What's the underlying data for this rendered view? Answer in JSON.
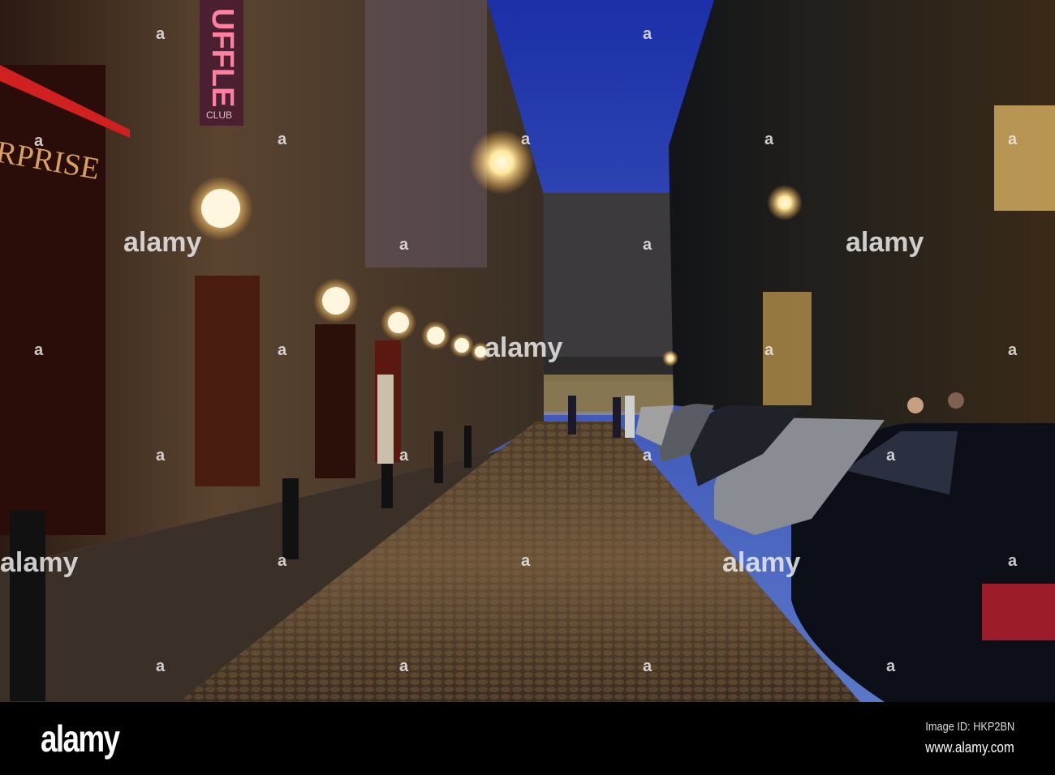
{
  "photo": {
    "signs": {
      "left_sign": "ERPRISE",
      "club_sign": "UFFLE",
      "club_subtitle": "CLUB"
    },
    "watermark": {
      "text": "alamy",
      "mark": "a"
    }
  },
  "footer": {
    "logo": "alamy",
    "image_id": "Image ID: HKP2BN",
    "url": "www.alamy.com"
  }
}
